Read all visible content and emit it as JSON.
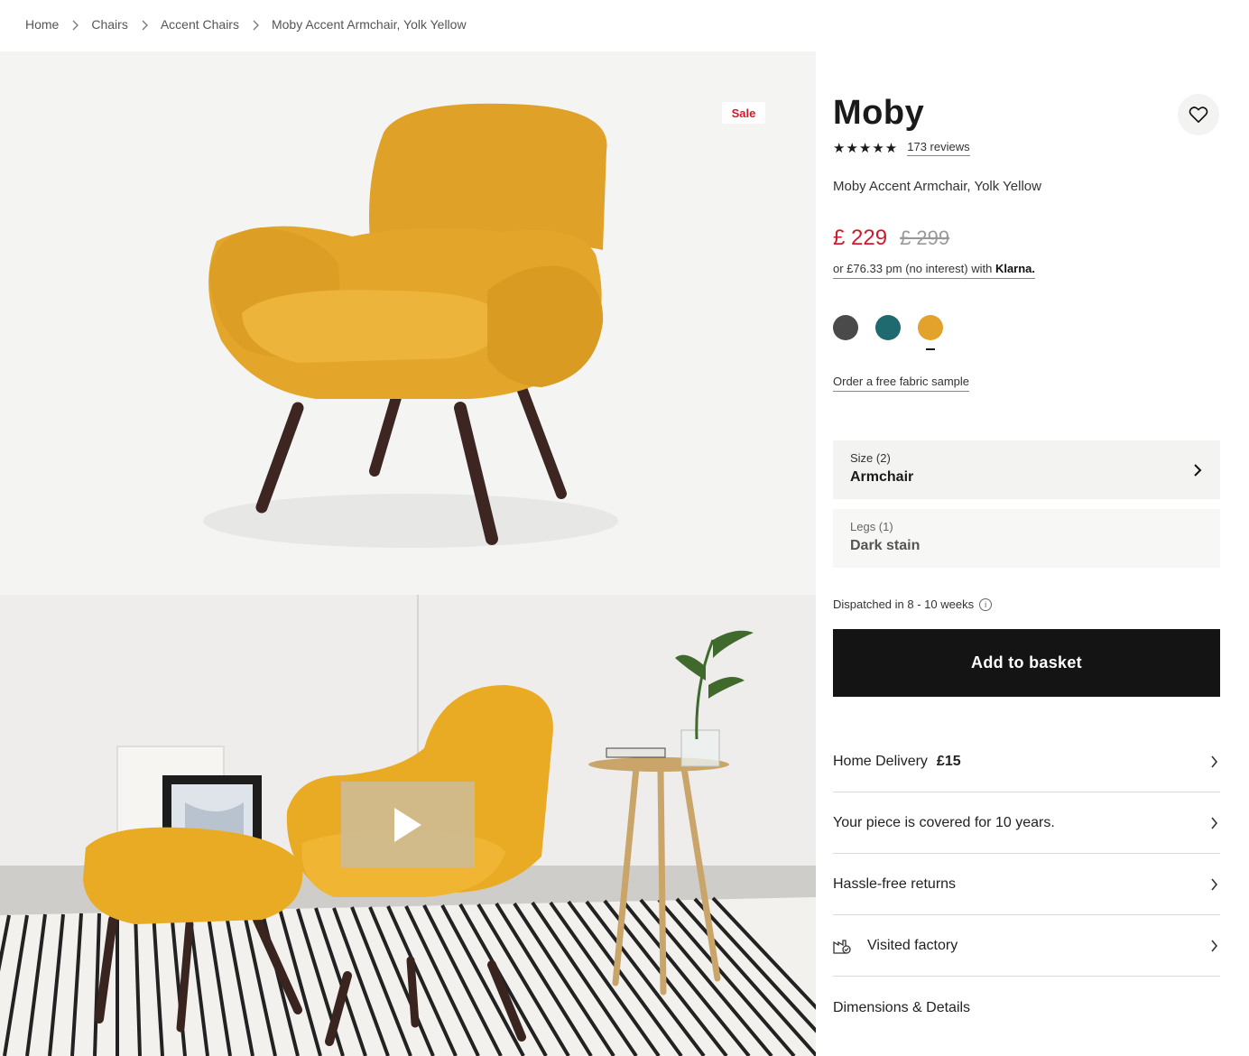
{
  "breadcrumb": {
    "items": [
      "Home",
      "Chairs",
      "Accent Chairs",
      "Moby Accent Armchair, Yolk Yellow"
    ]
  },
  "gallery": {
    "sale_badge": "Sale",
    "play_icon": "play-icon"
  },
  "product": {
    "title": "Moby",
    "stars": "★★★★★",
    "rating": 5,
    "reviews": "173 reviews",
    "subtitle": "Moby Accent Armchair, Yolk Yellow",
    "price": "£ 229",
    "old_price": "£ 299",
    "klarna_prefix": "or £76.33 pm (no interest) with",
    "klarna_brand": "Klarna.",
    "swatches": [
      {
        "name": "grey",
        "color": "#4a4a4b"
      },
      {
        "name": "teal",
        "color": "#1f6a6e"
      },
      {
        "name": "yellow",
        "color": "#e2a22c",
        "selected": true
      }
    ],
    "sample_link": "Order a free fabric sample",
    "wishlist_icon": "heart-icon"
  },
  "options": {
    "size": {
      "label": "Size (2)",
      "value": "Armchair"
    },
    "legs": {
      "label": "Legs (1)",
      "value": "Dark stain"
    }
  },
  "dispatch": {
    "text": "Dispatched in 8 - 10 weeks",
    "info": "i"
  },
  "basket": {
    "label": "Add to basket"
  },
  "info_rows": {
    "delivery_label": "Home Delivery",
    "delivery_price": "£15",
    "warranty": "Your piece is covered for 10 years.",
    "returns": "Hassle-free returns",
    "factory": "Visited factory",
    "dimensions": "Dimensions & Details"
  },
  "colors": {
    "accent_red": "#d0192a",
    "button_black": "#141414",
    "chair_yellow": "#e3a62a"
  }
}
